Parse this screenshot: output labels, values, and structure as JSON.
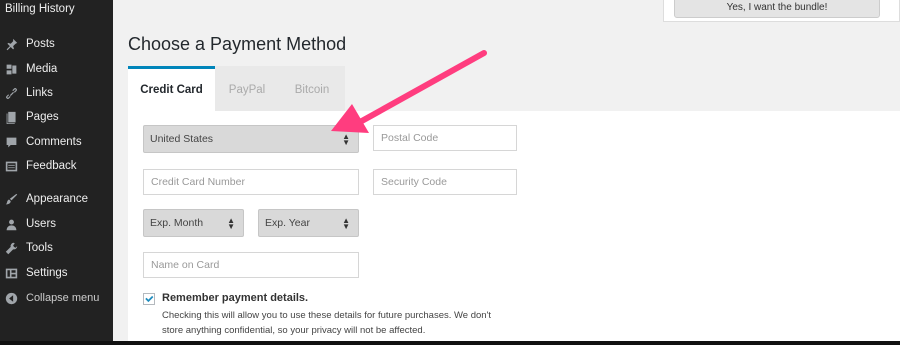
{
  "sidebar": {
    "top_item": "Billing History",
    "items": [
      {
        "label": "Posts",
        "icon": "pin-icon"
      },
      {
        "label": "Media",
        "icon": "media-icon"
      },
      {
        "label": "Links",
        "icon": "link-icon"
      },
      {
        "label": "Pages",
        "icon": "pages-icon"
      },
      {
        "label": "Comments",
        "icon": "comment-icon"
      },
      {
        "label": "Feedback",
        "icon": "feedback-icon"
      },
      {
        "label": "Appearance",
        "icon": "brush-icon"
      },
      {
        "label": "Users",
        "icon": "user-icon"
      },
      {
        "label": "Tools",
        "icon": "wrench-icon"
      },
      {
        "label": "Settings",
        "icon": "settings-icon"
      },
      {
        "label": "Collapse menu",
        "icon": "collapse-icon"
      }
    ]
  },
  "bundle_button": "Yes, I want the bundle!",
  "page_title": "Choose a Payment Method",
  "tabs": [
    {
      "label": "Credit Card",
      "active": true
    },
    {
      "label": "PayPal",
      "active": false
    },
    {
      "label": "Bitcoin",
      "active": false
    }
  ],
  "form": {
    "country": "United States",
    "postal_code_placeholder": "Postal Code",
    "card_number_placeholder": "Credit Card Number",
    "security_code_placeholder": "Security Code",
    "exp_month": "Exp. Month",
    "exp_year": "Exp. Year",
    "name_on_card_placeholder": "Name on Card",
    "remember_label": "Remember payment details.",
    "remember_checked": true,
    "remember_help_line1": "Checking this will allow you to use these details for future purchases. We don't",
    "remember_help_line2": "store anything confidential, so your privacy will not be affected."
  },
  "colors": {
    "sidebar_bg": "#222222",
    "accent": "#0085ba",
    "annotation_arrow": "#ff3d7f"
  }
}
